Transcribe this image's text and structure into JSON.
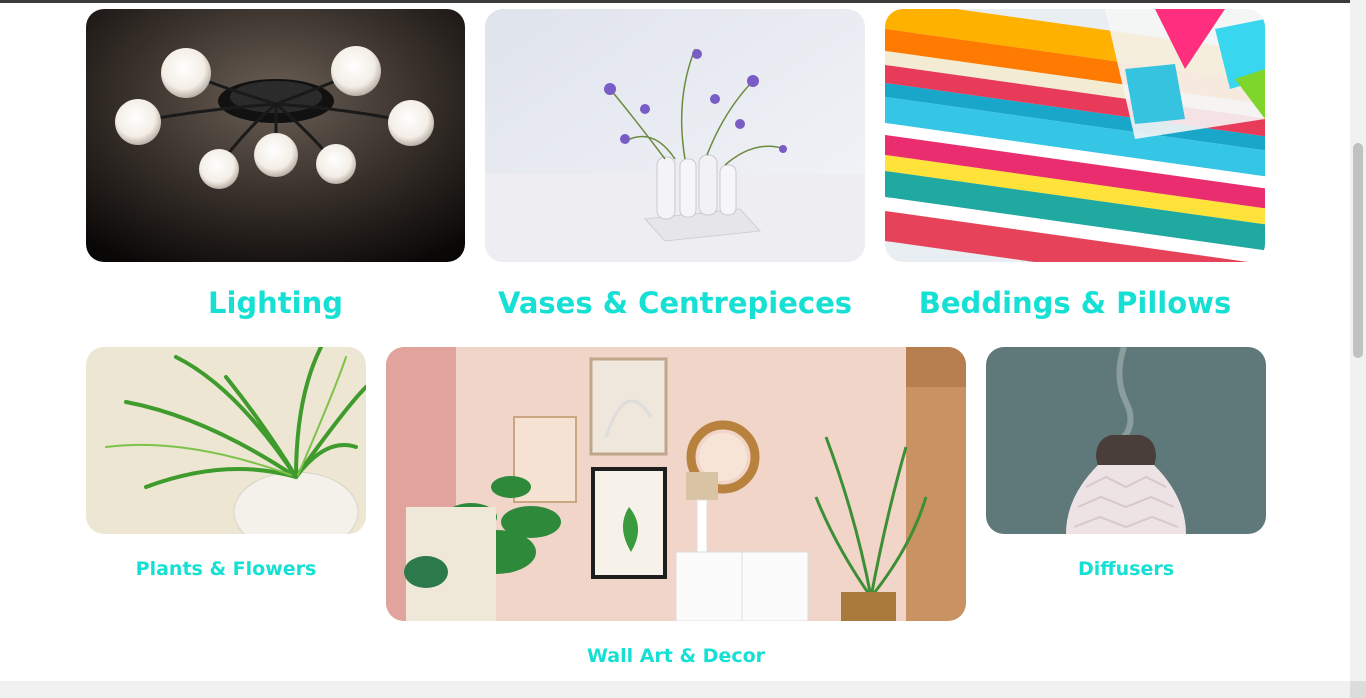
{
  "categories": {
    "lighting": {
      "label": "Lighting",
      "image": "ceiling-lamp-image"
    },
    "vases": {
      "label": "Vases & Centrepieces",
      "image": "vase-flowers-image"
    },
    "beddings": {
      "label": "Beddings & Pillows",
      "image": "striped-pillows-image"
    },
    "plants": {
      "label": "Plants & Flowers",
      "image": "potted-plant-image"
    },
    "wallart": {
      "label": "Wall Art & Decor",
      "image": "living-room-decor-image"
    },
    "diffusers": {
      "label": "Diffusers",
      "image": "aroma-diffuser-image"
    }
  },
  "colors": {
    "label": "#16e0d4",
    "background": "#ffffff",
    "scrollbar_thumb": "#c1c1c1"
  }
}
